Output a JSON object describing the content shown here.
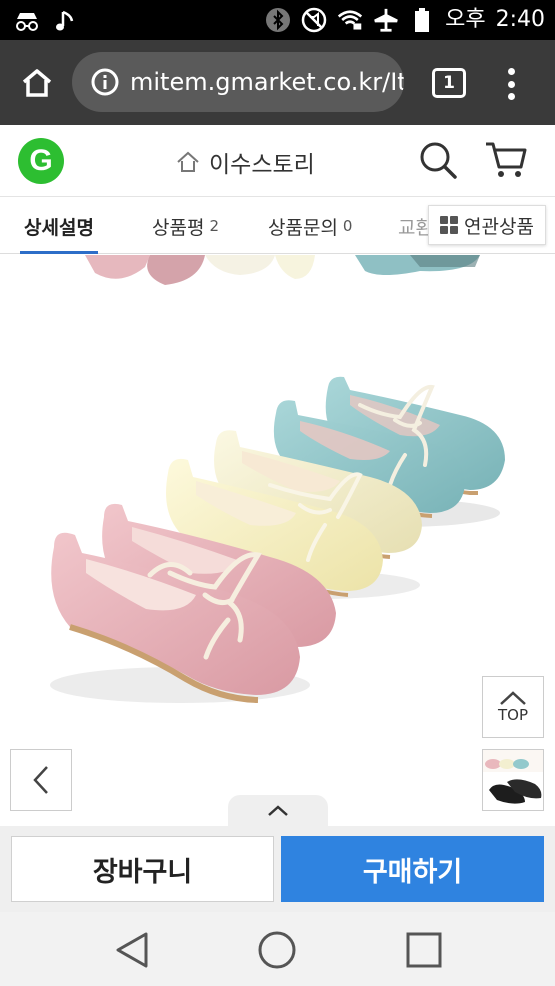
{
  "status_bar": {
    "carrier_text": "오후",
    "time": "2:40",
    "icons": [
      "incognito-icon",
      "music-icon",
      "bluetooth-icon",
      "mute-icon",
      "wifi-icon",
      "airplane-icon",
      "battery-icon"
    ]
  },
  "browser": {
    "url": "mitem.gmarket.co.kr/Ite",
    "tab_count": "1"
  },
  "site": {
    "logo_letter": "G",
    "store_name": "이수스토리"
  },
  "tabs": [
    {
      "label": "상세설명",
      "count": ""
    },
    {
      "label": "상품평",
      "count": "2"
    },
    {
      "label": "상품문의",
      "count": "0"
    },
    {
      "label": "교환",
      "count": ""
    }
  ],
  "related_products_label": "연관상품",
  "top_button_label": "TOP",
  "actions": {
    "cart_label": "장바구니",
    "buy_label": "구매하기"
  },
  "colors": {
    "accent_blue": "#2f83e0",
    "tab_underline": "#2d6ec8",
    "logo_green": "#2dbe31",
    "shoe_pink": "#e9b8bd",
    "shoe_cream": "#f3efd0",
    "shoe_blue": "#93c9cc"
  }
}
